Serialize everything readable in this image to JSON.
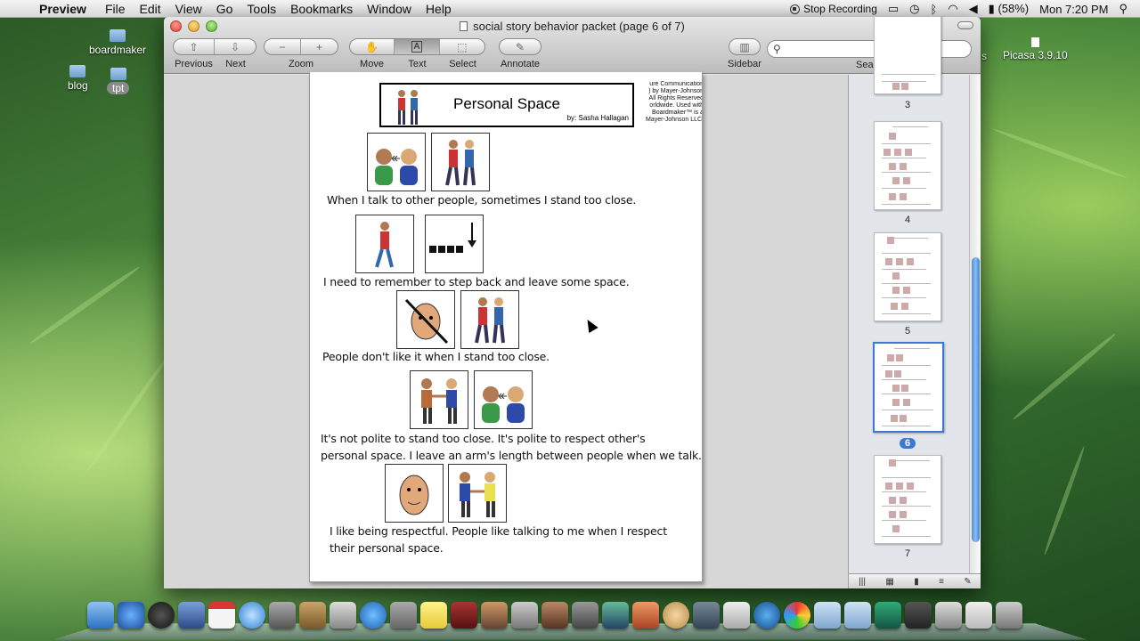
{
  "menubar": {
    "app": "Preview",
    "menus": [
      "File",
      "Edit",
      "View",
      "Go",
      "Tools",
      "Bookmarks",
      "Window",
      "Help"
    ],
    "status": {
      "recording": "Stop Recording",
      "battery": "(58%)",
      "clock": "Mon 7:20 PM"
    }
  },
  "desktop": {
    "icons": [
      "boardmaker",
      "blog",
      "tpt",
      "Picasa 3.9.10"
    ],
    "partial_label": "s"
  },
  "window": {
    "title": "social story behavior packet (page 6 of 7)",
    "toolbar": {
      "previous": "Previous",
      "next": "Next",
      "zoom": "Zoom",
      "move": "Move",
      "text": "Text",
      "select": "Select",
      "annotate": "Annotate",
      "sidebar": "Sidebar",
      "search": "Search",
      "search_value": ""
    }
  },
  "page": {
    "title": "Personal Space",
    "author": "by: Sasha Hallagan",
    "copyright": "ure Communication\n) by Mayer-Johnson\nAll Rights Reserved\norldwide. Used with\nBoardmaker™ is a\nMayer-Johnson LLC.",
    "captions": [
      "When I talk to other people, sometimes I stand too close.",
      "I need to remember to step back and leave some space.",
      "People don't like it when I stand too close.",
      "It's not polite to stand too close. It's polite to respect other's",
      "personal space. I leave an arm's length between people when we talk.",
      "I like being respectful. People like talking to me when I respect",
      "their personal space."
    ]
  },
  "sidebar": {
    "pages": [
      "3",
      "4",
      "5",
      "6",
      "7"
    ],
    "selected": "6"
  },
  "colors": {
    "accent": "#3b79d6",
    "selected_badge": "#3b79d6"
  }
}
